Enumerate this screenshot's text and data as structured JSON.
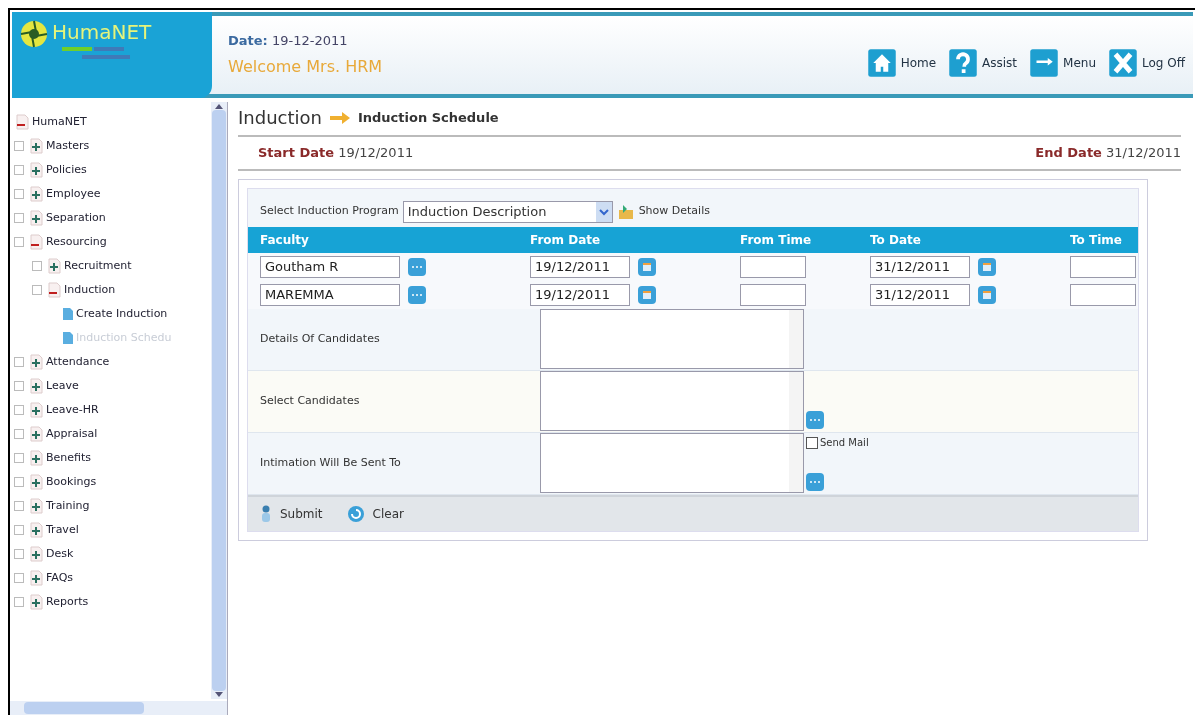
{
  "header": {
    "logo": "HumaNET",
    "date_label": "Date:",
    "date": "19-12-2011",
    "welcome": "Welcome Mrs. HRM",
    "actions": [
      {
        "kind": "home",
        "label": "Home"
      },
      {
        "kind": "assist",
        "label": "Assist"
      },
      {
        "kind": "menu",
        "label": "Menu"
      },
      {
        "kind": "logoff",
        "label": "Log Off"
      }
    ]
  },
  "sidebar": {
    "root": {
      "label": "HumaNET",
      "expanded": true,
      "children": [
        {
          "kind": "folder",
          "label": "Masters",
          "expanded": false
        },
        {
          "kind": "folder",
          "label": "Policies",
          "expanded": false
        },
        {
          "kind": "folder",
          "label": "Employee",
          "expanded": false
        },
        {
          "kind": "folder",
          "label": "Separation",
          "expanded": false
        },
        {
          "kind": "folder",
          "label": "Resourcing",
          "expanded": true,
          "children": [
            {
              "kind": "folder",
              "label": "Recruitment",
              "expanded": false
            },
            {
              "kind": "folder",
              "label": "Induction",
              "expanded": true,
              "children": [
                {
                  "kind": "page",
                  "label": "Create Induction",
                  "disabled": false
                },
                {
                  "kind": "page",
                  "label": "Induction Schedu",
                  "disabled": true
                }
              ]
            }
          ]
        },
        {
          "kind": "folder",
          "label": "Attendance",
          "expanded": false
        },
        {
          "kind": "folder",
          "label": "Leave",
          "expanded": false
        },
        {
          "kind": "folder",
          "label": "Leave-HR",
          "expanded": false
        },
        {
          "kind": "folder",
          "label": "Appraisal",
          "expanded": false
        },
        {
          "kind": "folder",
          "label": "Benefits",
          "expanded": false
        },
        {
          "kind": "folder",
          "label": "Bookings",
          "expanded": false
        },
        {
          "kind": "folder",
          "label": "Training",
          "expanded": false
        },
        {
          "kind": "folder",
          "label": "Travel",
          "expanded": false
        },
        {
          "kind": "folder",
          "label": "Desk",
          "expanded": false
        },
        {
          "kind": "folder",
          "label": "FAQs",
          "expanded": false
        },
        {
          "kind": "folder",
          "label": "Reports",
          "expanded": false
        }
      ]
    }
  },
  "breadcrumb": [
    "Induction",
    "Induction Schedule"
  ],
  "start_date": {
    "label": "Start Date",
    "value": "19/12/2011"
  },
  "end_date": {
    "label": "End Date",
    "value": "31/12/2011"
  },
  "program": {
    "label": "Select Induction Program",
    "value": "Induction Description",
    "show_details": "Show Details"
  },
  "table": {
    "columns": [
      "Faculty",
      "From Date",
      "From Time",
      "To Date",
      "To Time"
    ],
    "rows": [
      {
        "faculty": "Goutham R",
        "from_date": "19/12/2011",
        "to_date": "31/12/2011"
      },
      {
        "faculty": "MAREMMA",
        "from_date": "19/12/2011",
        "to_date": "31/12/2011"
      }
    ]
  },
  "fields": [
    {
      "label": "Details Of Candidates",
      "picker": false
    },
    {
      "label": "Select Candidates",
      "picker": true
    },
    {
      "label": "Intimation Will Be Sent To",
      "picker": true,
      "send_mail": {
        "label": "Send Mail",
        "checked": false
      }
    }
  ],
  "buttons": [
    {
      "kind": "submit",
      "label": "Submit"
    },
    {
      "kind": "clear",
      "label": "Clear"
    }
  ]
}
